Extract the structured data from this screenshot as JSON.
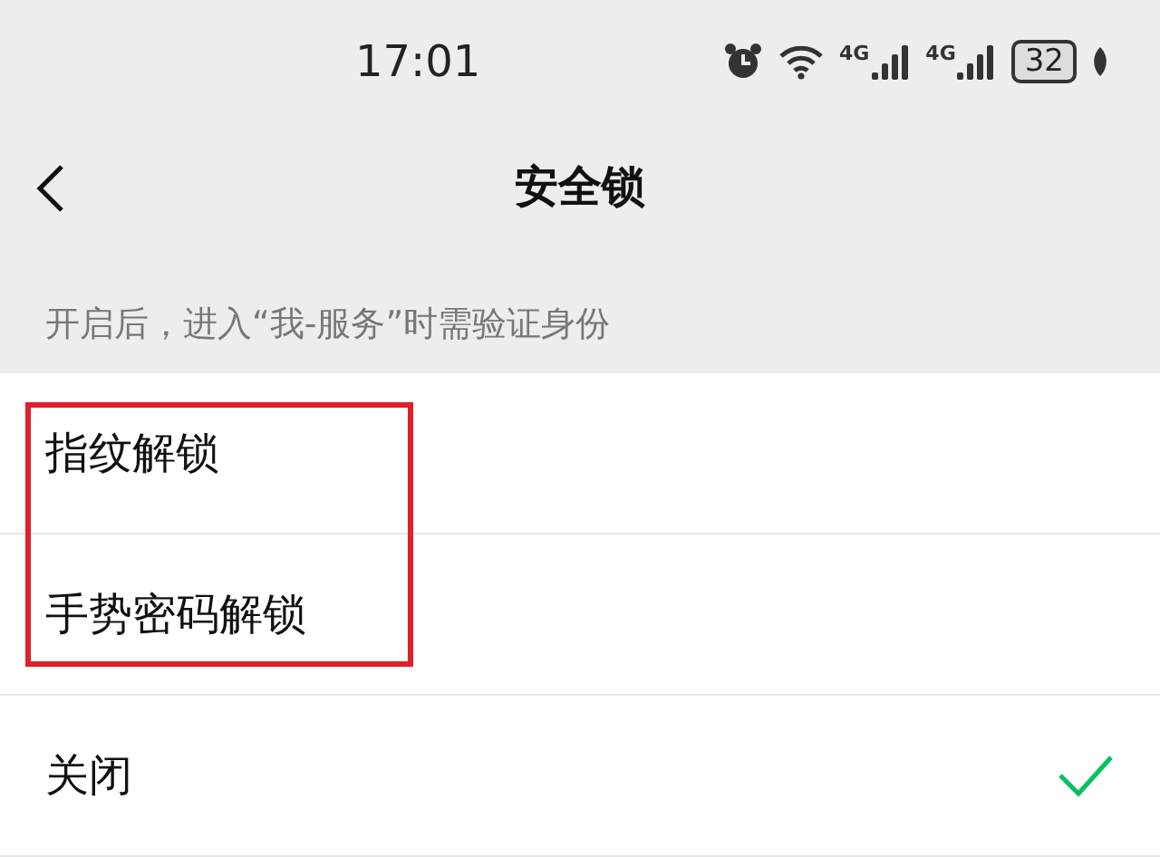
{
  "status_bar": {
    "time": "17:01",
    "network_labels": [
      "4G",
      "4G"
    ],
    "battery": "32"
  },
  "nav": {
    "title": "安全锁"
  },
  "hint": "开启后，进入“我-服务”时需验证身份",
  "options": [
    {
      "label": "指纹解锁",
      "selected": false,
      "highlighted": true
    },
    {
      "label": "手势密码解锁",
      "selected": false,
      "highlighted": true
    },
    {
      "label": "关闭",
      "selected": true,
      "highlighted": false
    }
  ]
}
